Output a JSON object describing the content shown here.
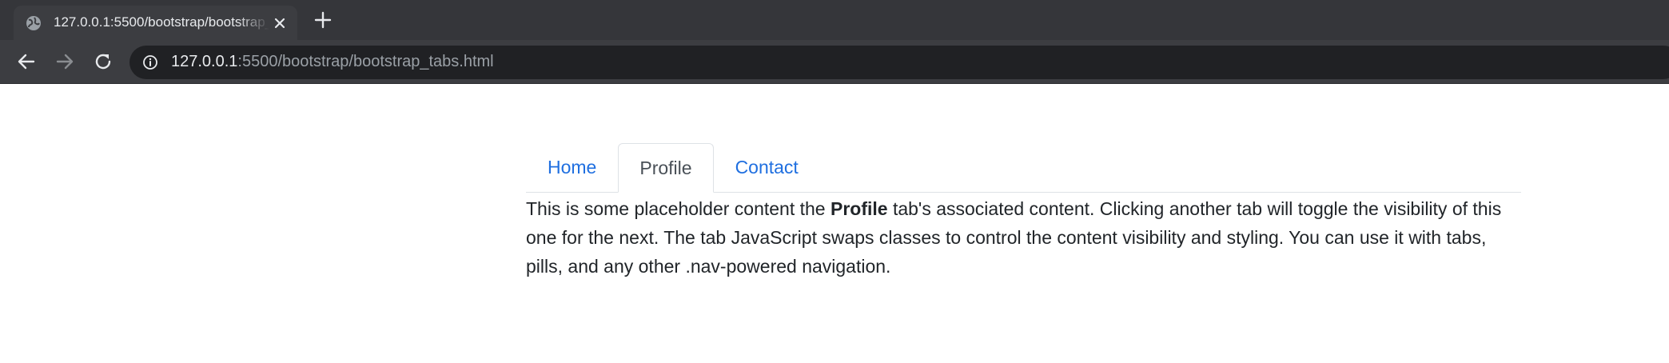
{
  "browser": {
    "tab_title": "127.0.0.1:5500/bootstrap/bootstrap_tabs.html",
    "url_host": "127.0.0.1",
    "url_rest": ":5500/bootstrap/bootstrap_tabs.html"
  },
  "nav_tabs": [
    {
      "label": "Home",
      "active": false
    },
    {
      "label": "Profile",
      "active": true
    },
    {
      "label": "Contact",
      "active": false
    }
  ],
  "content": {
    "part1": "This is some placeholder content the ",
    "bold": "Profile",
    "part2": " tab's associated content. Clicking another tab will toggle the visibility of this one for the next. The tab JavaScript swaps classes to control the content visibility and styling. You can use it with tabs, pills, and any other .nav-powered navigation."
  },
  "colors": {
    "link": "#1f6fe0",
    "active_tab_text": "#495057",
    "chrome_dark": "#35363a"
  }
}
